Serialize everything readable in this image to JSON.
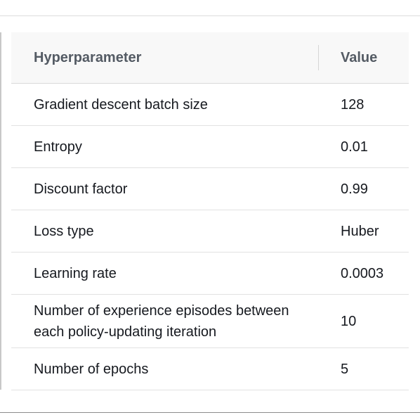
{
  "table": {
    "headers": [
      "Hyperparameter",
      "Value"
    ],
    "rows": [
      {
        "name": "Gradient descent batch size",
        "value": "128"
      },
      {
        "name": "Entropy",
        "value": "0.01"
      },
      {
        "name": "Discount factor",
        "value": "0.99"
      },
      {
        "name": "Loss type",
        "value": "Huber"
      },
      {
        "name": "Learning rate",
        "value": "0.0003"
      },
      {
        "name": "Number of experience episodes between each policy-updating iteration",
        "value": "10"
      },
      {
        "name": "Number of epochs",
        "value": "5"
      }
    ]
  }
}
